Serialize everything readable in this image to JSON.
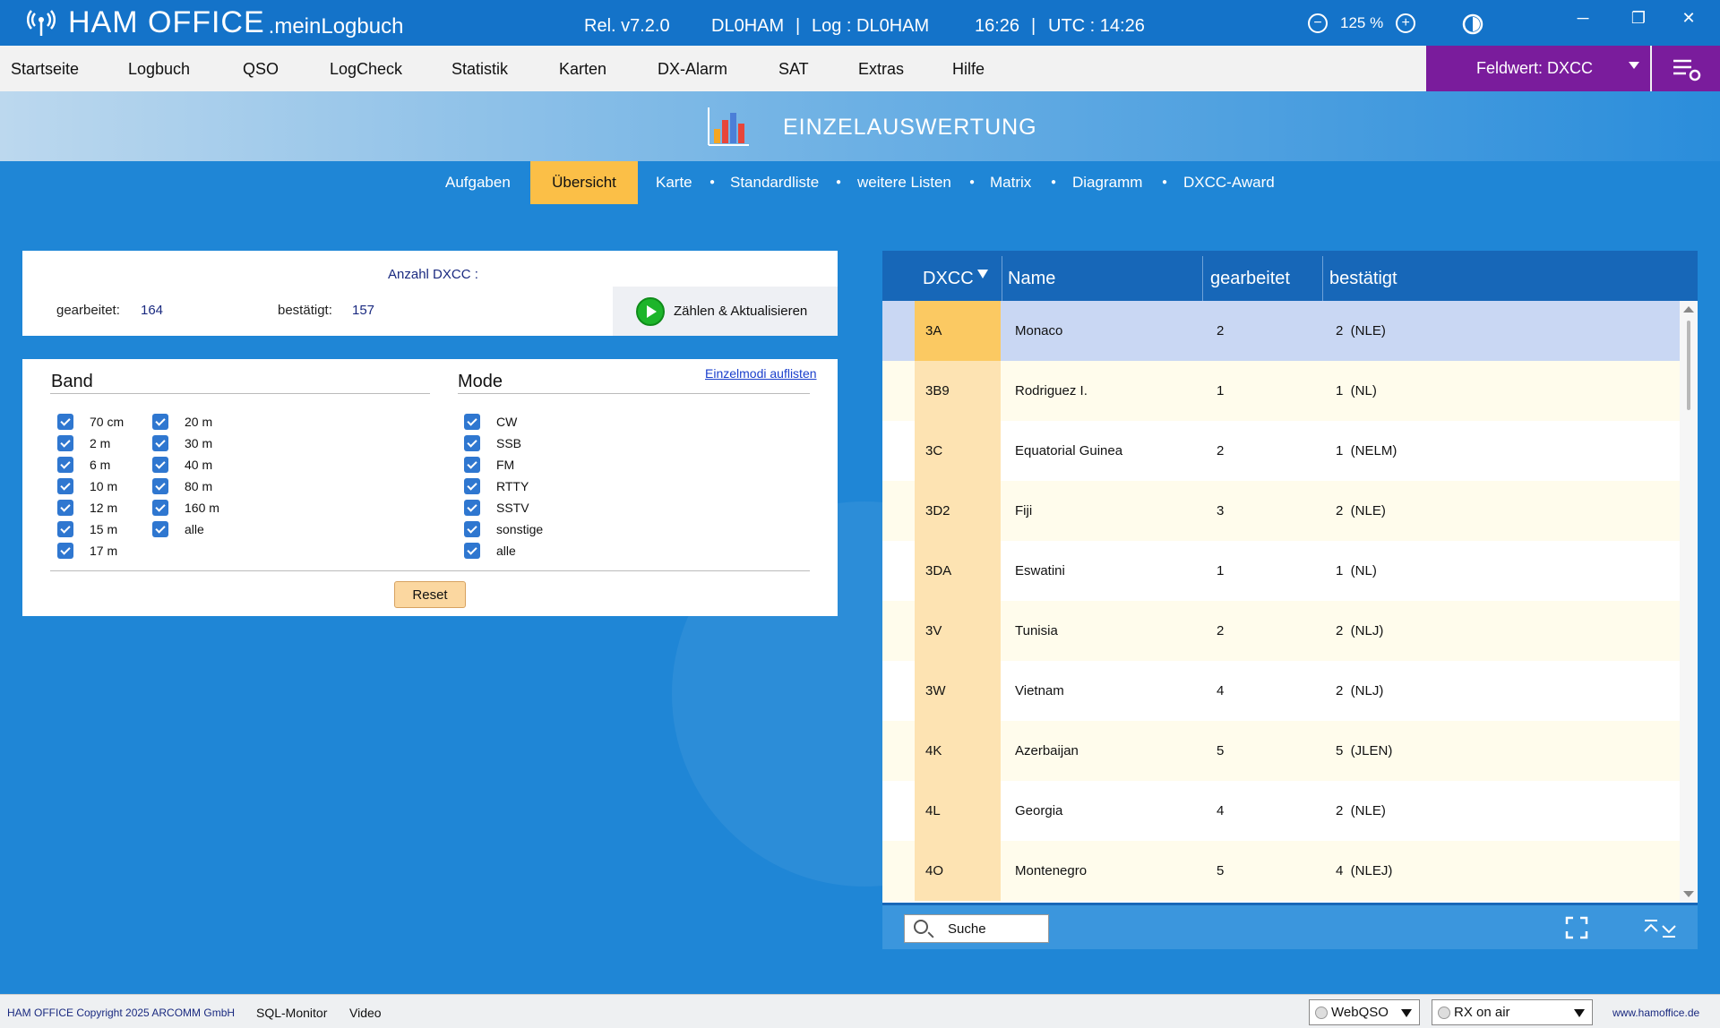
{
  "titlebar": {
    "brand": "HAM OFFICE",
    "brand_sub": ".meinLogbuch",
    "release": "Rel. v7.2.0",
    "call": "DL0HAM",
    "sep1": "|",
    "log": "Log : DL0HAM",
    "time": "16:26",
    "sep2": "|",
    "utc": "UTC : 14:26",
    "zoom": "125 %"
  },
  "menu": {
    "items": [
      "Startseite",
      "Logbuch",
      "QSO",
      "LogCheck",
      "Statistik",
      "Karten",
      "DX-Alarm",
      "SAT",
      "Extras",
      "Hilfe"
    ],
    "feldwert": "Feldwert:  DXCC"
  },
  "header": {
    "title": "EINZELAUSWERTUNG"
  },
  "subtabs": [
    "Aufgaben",
    "Übersicht",
    "Karte",
    "Standardliste",
    "weitere Listen",
    "Matrix",
    "Diagramm",
    "DXCC-Award"
  ],
  "summary": {
    "title": "Anzahl DXCC :",
    "worked_label": "gearbeitet:",
    "worked_value": "164",
    "confirmed_label": "bestätigt:",
    "confirmed_value": "157",
    "count_button": "Zählen & Aktualisieren"
  },
  "filters": {
    "band_title": "Band",
    "mode_title": "Mode",
    "einzelmodi_link": "Einzelmodi auflisten",
    "bands_col1": [
      "70 cm",
      "2 m",
      "6 m",
      "10 m",
      "12 m",
      "15 m",
      "17 m"
    ],
    "bands_col2": [
      "20 m",
      "30 m",
      "40 m",
      "80 m",
      "160 m",
      "alle"
    ],
    "modes": [
      "CW",
      "SSB",
      "FM",
      "RTTY",
      "SSTV",
      "sonstige",
      "alle"
    ],
    "reset_label": "Reset"
  },
  "table": {
    "headers": [
      "DXCC",
      "Name",
      "gearbeitet",
      "bestätigt"
    ],
    "rows": [
      [
        "3A",
        "Monaco",
        "2",
        "2  (NLE)"
      ],
      [
        "3B9",
        "Rodriguez I.",
        "1",
        "1  (NL)"
      ],
      [
        "3C",
        "Equatorial Guinea",
        "2",
        "1  (NELM)"
      ],
      [
        "3D2",
        "Fiji",
        "3",
        "2  (NLE)"
      ],
      [
        "3DA",
        "Eswatini",
        "1",
        "1  (NL)"
      ],
      [
        "3V",
        "Tunisia",
        "2",
        "2  (NLJ)"
      ],
      [
        "3W",
        "Vietnam",
        "4",
        "2  (NLJ)"
      ],
      [
        "4K",
        "Azerbaijan",
        "5",
        "5  (JLEN)"
      ],
      [
        "4L",
        "Georgia",
        "4",
        "2  (NLE)"
      ],
      [
        "4O",
        "Montenegro",
        "5",
        "4  (NLEJ)"
      ]
    ],
    "search_placeholder": "Suche"
  },
  "statusbar": {
    "copyright": "HAM OFFICE Copyright 2025 ARCOMM GmbH",
    "sql_monitor": "SQL-Monitor",
    "video": "Video",
    "webqso": "WebQSO",
    "rx": "RX on air",
    "site": "www.hamoffice.de"
  },
  "colors": {
    "titlebar": "#1473c9",
    "accent_tab": "#fbbf47",
    "feldwert": "#7a1c9c",
    "table_header": "#1767b8"
  }
}
